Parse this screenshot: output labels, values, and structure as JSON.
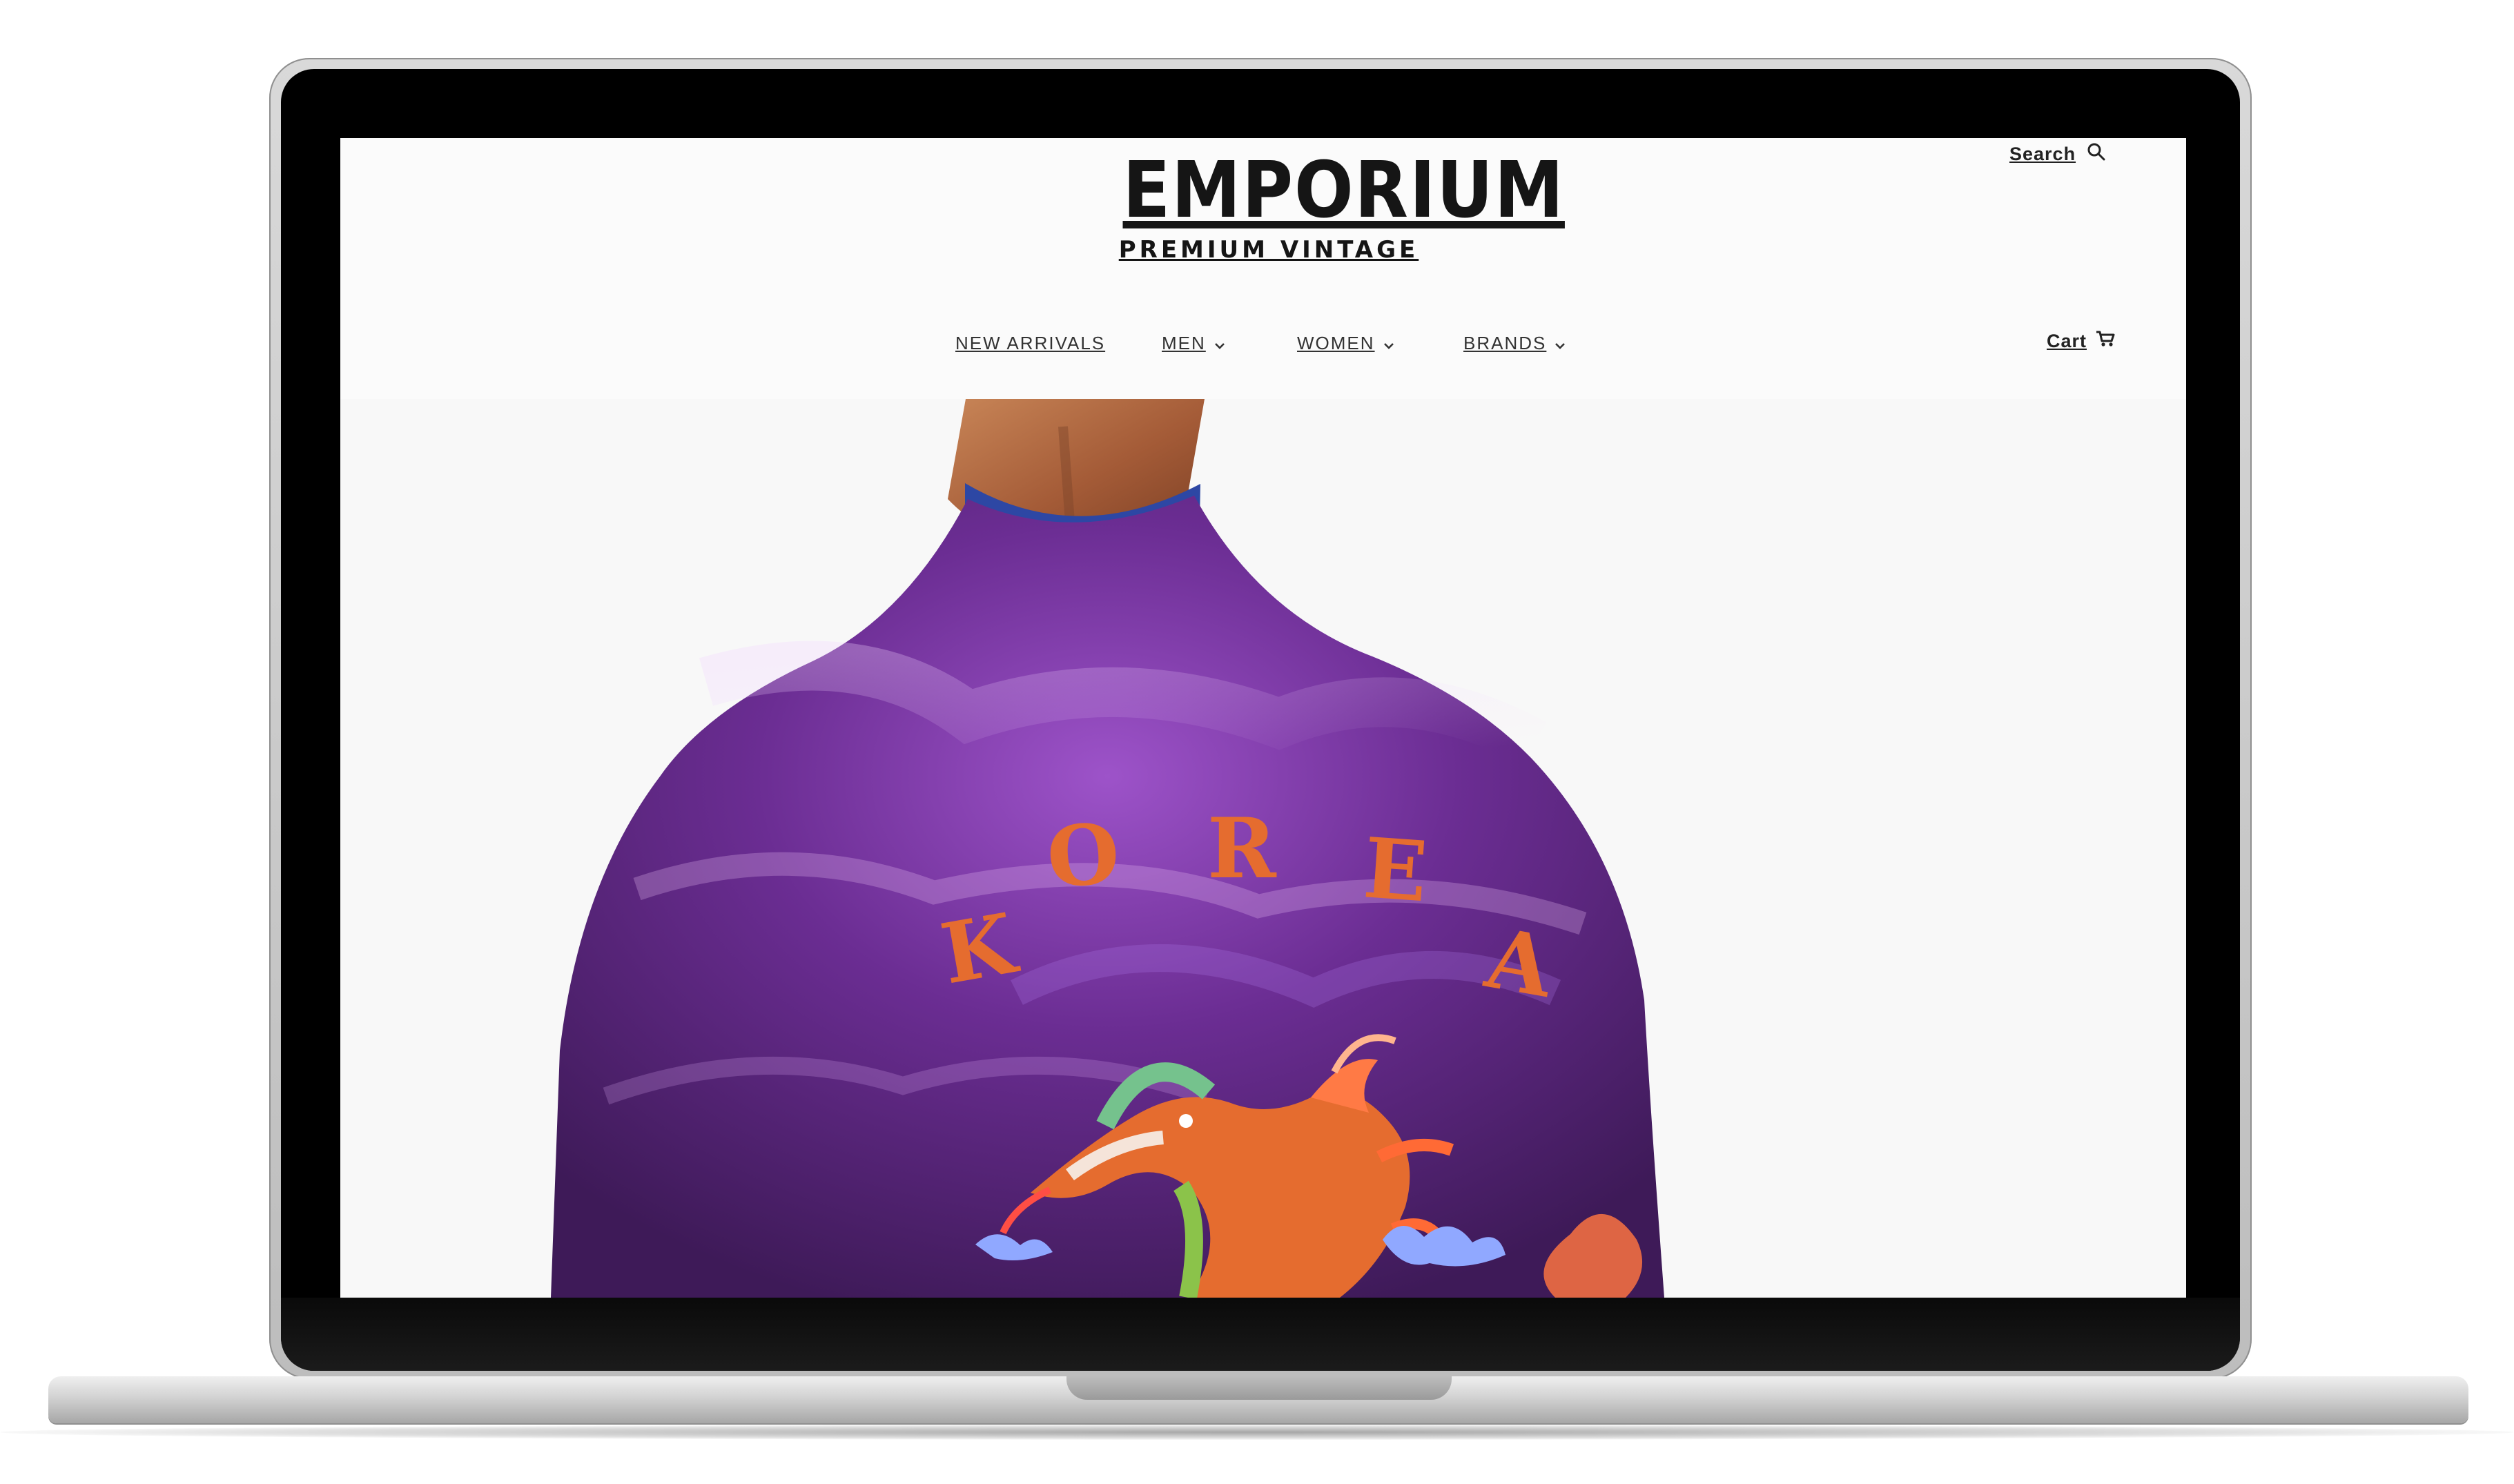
{
  "header": {
    "brand": "EMPORIUM",
    "tagline": "PREMIUM VINTAGE",
    "search_label": "Search",
    "cart_label": "Cart"
  },
  "nav": {
    "items": [
      {
        "label": "NEW ARRIVALS",
        "has_dropdown": false
      },
      {
        "label": "MEN",
        "has_dropdown": true
      },
      {
        "label": "WOMEN",
        "has_dropdown": true
      },
      {
        "label": "BRANDS",
        "has_dropdown": true
      }
    ]
  },
  "hero": {
    "embroidery_text": "KOREA"
  },
  "colors": {
    "page_bg": "#fafafa",
    "jacket_purple": "#6b2d93",
    "embroidery_orange": "#e56c2f",
    "hair": "#b86d45"
  },
  "icons": {
    "search": "search-icon",
    "cart": "cart-icon",
    "dropdown": "chevron-down-icon"
  }
}
